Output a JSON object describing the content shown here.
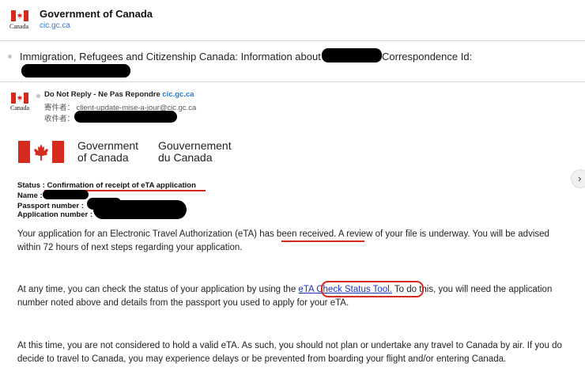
{
  "sender_header": {
    "flag_word": "Canada",
    "title": "Government of Canada",
    "domain": "cic.gc.ca"
  },
  "subject": {
    "text_before": "Immigration, Refugees and Citizenship Canada: Information about",
    "text_after": "Correspondence Id:"
  },
  "email_meta": {
    "flag_word": "Canada",
    "from_name": "Do Not Reply - Ne Pas Repondre",
    "from_addr": "cic.gc.ca",
    "sender_label": "寄件者：",
    "sender_value": "client-update-mise-a-jour@cic.gc.ca",
    "recipient_label": "收件者："
  },
  "logo": {
    "en_line1": "Government",
    "en_line2": "of Canada",
    "fr_line1": "Gouvernement",
    "fr_line2": "du Canada"
  },
  "status": {
    "status_line": "Status : Confirmation of receipt of eTA application",
    "name_label": "Name :",
    "passport_label": "Passport number :",
    "application_label": "Application number :"
  },
  "body": {
    "p1_a": "Your application for an Electronic Travel Authorization (eTA) has been received. A review of your file is underway. You will be advised within 72 hours of next steps regarding your application.",
    "p2_before": "At any time, you can check the status of your application by using the ",
    "p2_link": "eTA Check Status Tool.",
    "p2_after": " To do this, you will need the application number noted above and details from the passport you used to apply for your eTA.",
    "p3": "At this time, you are not considered to hold a valid eTA. As such, you should not plan or undertake any travel to Canada by air. If you do decide to travel to Canada, you may experience delays or be prevented from boarding your flight and/or entering Canada."
  },
  "icons": {
    "next": "chevron-right-icon"
  },
  "colors": {
    "brand_red": "#d52b1e",
    "link_blue": "#2a7bd4"
  }
}
